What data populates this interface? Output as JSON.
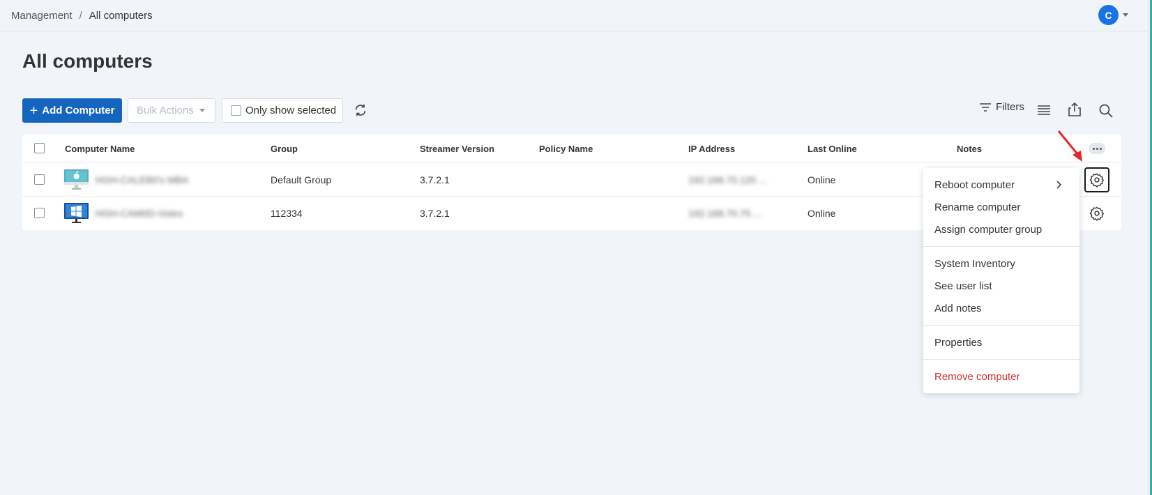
{
  "breadcrumb": {
    "parent": "Management",
    "separator": "/",
    "current": "All computers"
  },
  "user": {
    "initial": "C"
  },
  "page_title": "All computers",
  "toolbar": {
    "add_label": "Add Computer",
    "bulk_label": "Bulk Actions",
    "only_selected_label": "Only show selected",
    "filters_label": "Filters"
  },
  "table": {
    "headers": {
      "name": "Computer Name",
      "group": "Group",
      "streamer": "Streamer Version",
      "policy": "Policy Name",
      "ip": "IP Address",
      "last_online": "Last Online",
      "notes": "Notes"
    },
    "rows": [
      {
        "name": "HGH-CALEB0's MBA",
        "os": "mac",
        "group": "Default Group",
        "streamer": "3.7.2.1",
        "policy": "",
        "ip": "192.168.70.120 ...",
        "last_online": "Online"
      },
      {
        "name": "HGH-CAM0D-Vistro",
        "os": "windows",
        "group": "112334",
        "streamer": "3.7.2.1",
        "policy": "",
        "ip": "192.168.70.75 ...",
        "last_online": "Online"
      }
    ]
  },
  "menu": {
    "items": [
      "Reboot computer",
      "Rename computer",
      "Assign computer group",
      "System Inventory",
      "See user list",
      "Add notes",
      "Properties",
      "Remove computer"
    ]
  },
  "colors": {
    "primary": "#1565c0",
    "danger": "#d32f2f",
    "accent": "#2bb3a3",
    "annotation_arrow": "#e8262a"
  },
  "icons": [
    "plus-icon",
    "refresh-icon",
    "filter-icon",
    "columns-icon",
    "export-icon",
    "search-icon",
    "gear-icon",
    "more-icon",
    "chevron-right-icon",
    "mac-monitor-icon",
    "windows-monitor-icon"
  ]
}
